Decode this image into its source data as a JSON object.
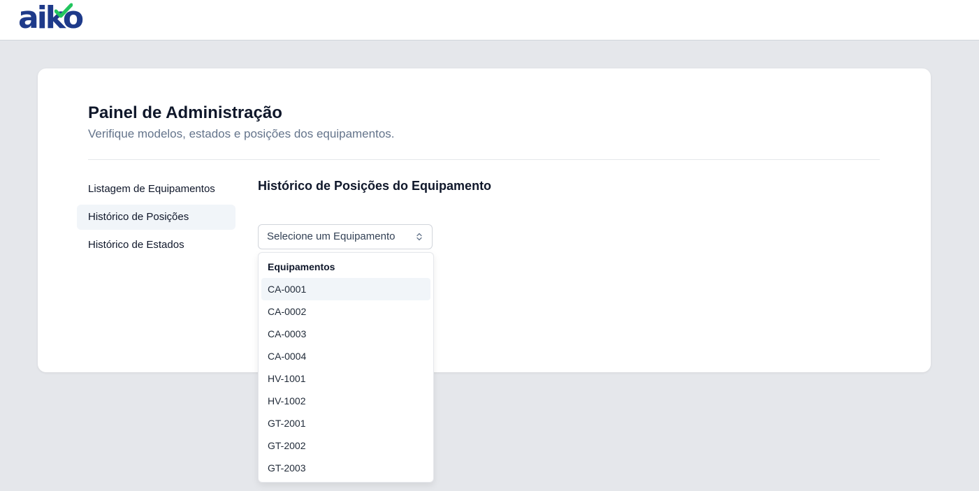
{
  "header": {
    "logo_text": "aiko"
  },
  "admin": {
    "title": "Painel de Administração",
    "subtitle": "Verifique modelos, estados e posições dos equipamentos."
  },
  "sidebar": {
    "items": [
      {
        "label": "Listagem de Equipamentos"
      },
      {
        "label": "Histórico de Posições"
      },
      {
        "label": "Histórico de Estados"
      }
    ],
    "active_index": 1
  },
  "main": {
    "section_title": "Histórico de Posições do Equipamento",
    "select": {
      "placeholder": "Selecione um Equipamento"
    },
    "dropdown": {
      "group_label": "Equipamentos",
      "highlighted_index": 0,
      "options": [
        {
          "label": "CA-0001"
        },
        {
          "label": "CA-0002"
        },
        {
          "label": "CA-0003"
        },
        {
          "label": "CA-0004"
        },
        {
          "label": "HV-1001"
        },
        {
          "label": "HV-1002"
        },
        {
          "label": "GT-2001"
        },
        {
          "label": "GT-2002"
        },
        {
          "label": "GT-2003"
        }
      ]
    }
  },
  "colors": {
    "brand_blue": "#1e3a8a",
    "brand_green": "#22c55e",
    "page_background": "#e5e7eb",
    "active_nav_background": "#f1f5f9"
  }
}
